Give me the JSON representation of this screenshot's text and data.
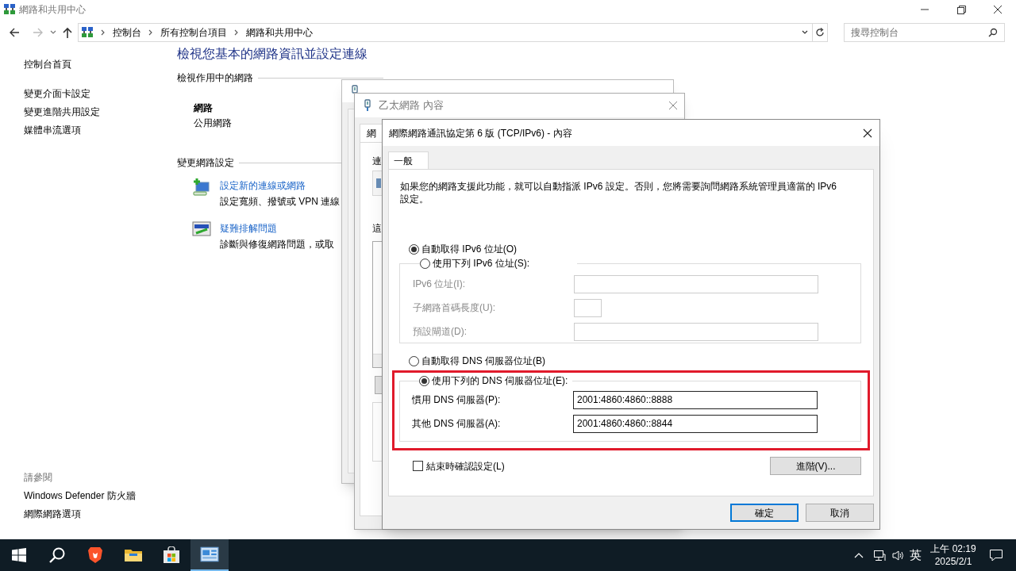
{
  "window": {
    "title": "網路和共用中心"
  },
  "address_bar": {
    "breadcrumbs": [
      "控制台",
      "所有控制台項目",
      "網路和共用中心"
    ]
  },
  "search": {
    "placeholder": "搜尋控制台"
  },
  "sidebar": {
    "items": [
      "控制台首頁",
      "變更介面卡設定",
      "變更進階共用設定",
      "媒體串流選項"
    ],
    "see_also_title": "請參閱",
    "see_also": [
      "Windows Defender 防火牆",
      "網際網路選項"
    ]
  },
  "main": {
    "heading": "檢視您基本的網路資訊並設定連線",
    "active_networks_title": "檢視作用中的網路",
    "network_name": "網路",
    "network_type": "公用網路",
    "change_settings_title": "變更網路設定",
    "tasks": [
      {
        "kind": "new-connection",
        "link": "設定新的連線或網路",
        "description": "設定寬頻、撥號或 VPN 連線"
      },
      {
        "kind": "troubleshoot",
        "link": "疑難排解問題",
        "description": "診斷與修復網路問題，或取"
      }
    ]
  },
  "properties_dialog": {
    "title": "乙太網路 內容",
    "tab": "網",
    "label_1": "連",
    "label_2": "這"
  },
  "ipv6_dialog": {
    "title": "網際網路通訊協定第 6 版 (TCP/IPv6) - 內容",
    "tabs": [
      {
        "label": "一般",
        "selected": true
      }
    ],
    "description": "如果您的網路支援此功能，就可以自動指派 IPv6 設定。否則，您將需要詢問網路系統管理員適當的 IPv6 設定。",
    "address_options": [
      {
        "label": "自動取得 IPv6 位址(O)",
        "selected": true
      },
      {
        "label": "使用下列 IPv6 位址(S):",
        "selected": false
      }
    ],
    "address_fields": [
      {
        "label": "IPv6 位址(I):",
        "disabled": true,
        "kind": "wide"
      },
      {
        "label": "子網路首碼長度(U):",
        "disabled": true,
        "kind": "short"
      },
      {
        "label": "預設閘道(D):",
        "disabled": true,
        "kind": "wide"
      }
    ],
    "dns_options": [
      {
        "label": "自動取得 DNS 伺服器位址(B)",
        "selected": false
      },
      {
        "label": "使用下列的 DNS 伺服器位址(E):",
        "selected": true
      }
    ],
    "dns_fields": [
      {
        "label": "慣用 DNS 伺服器(P):",
        "value": "2001:4860:4860::8888"
      },
      {
        "label": "其他 DNS 伺服器(A):",
        "value": "2001:4860:4860::8844"
      }
    ],
    "validate": {
      "label": "結束時確認設定(L)",
      "checked": false
    },
    "advanced_button": "進階(V)...",
    "buttons": [
      {
        "label": "確定",
        "default": true
      },
      {
        "label": "取消",
        "default": false
      }
    ]
  },
  "taskbar": {
    "apps": [
      {
        "kind": "browser",
        "active": false
      },
      {
        "kind": "folder",
        "active": false
      },
      {
        "kind": "store",
        "active": false
      },
      {
        "kind": "control-panel",
        "active": true
      }
    ],
    "language": "英",
    "time": "上午 02:19",
    "date": "2025/2/1"
  }
}
